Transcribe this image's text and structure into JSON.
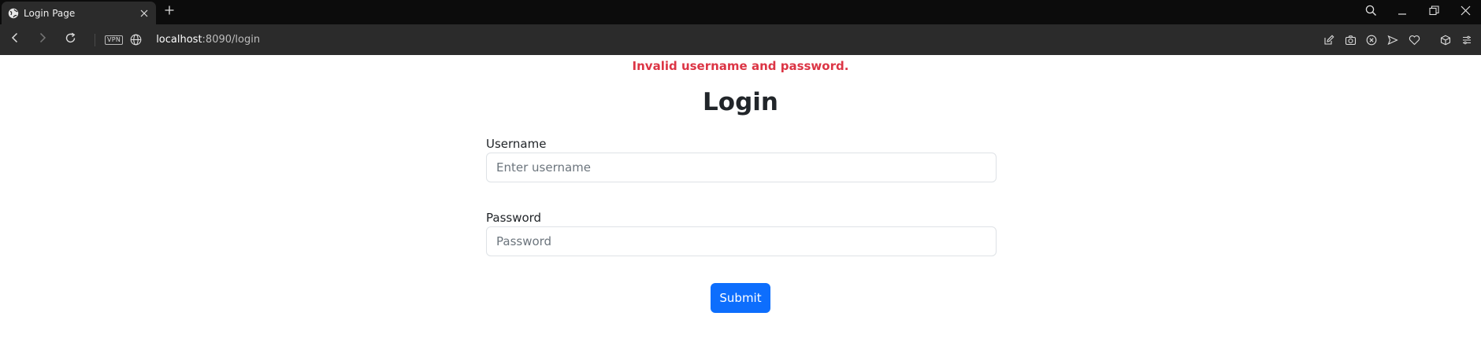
{
  "browser": {
    "tab": {
      "title": "Login Page",
      "favicon": "globe-icon",
      "close": "close-icon"
    },
    "new_tab": "plus-icon",
    "window_controls": [
      "search-icon",
      "minimize-icon",
      "restore-icon",
      "close-icon"
    ],
    "nav": [
      "back-icon",
      "forward-icon",
      "reload-icon"
    ],
    "vpn_badge": "VPN",
    "url": {
      "host": "localhost",
      "path": ":8090/login"
    },
    "toolbar_icons": [
      "edit-icon",
      "camera-icon",
      "blocker-icon",
      "send-icon",
      "heart-icon",
      "cube-icon",
      "menu-icon"
    ]
  },
  "page": {
    "error_message": "Invalid username and password.",
    "heading": "Login",
    "username": {
      "label": "Username",
      "placeholder": "Enter username",
      "value": ""
    },
    "password": {
      "label": "Password",
      "placeholder": "Password",
      "value": ""
    },
    "submit_label": "Submit"
  },
  "colors": {
    "error": "#dc3545",
    "primary": "#0d6efd",
    "text": "#212529",
    "chrome_dark": "#0c0c0c",
    "chrome_toolbar": "#2b2b2b"
  }
}
